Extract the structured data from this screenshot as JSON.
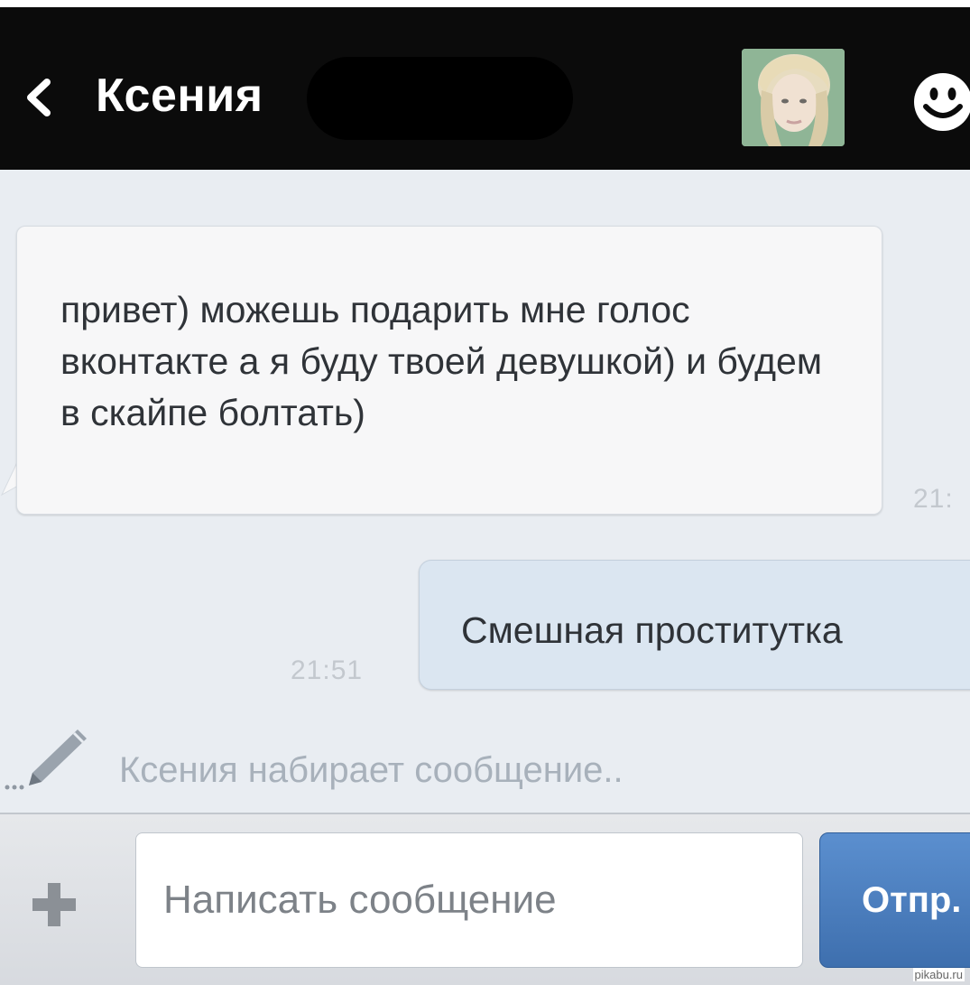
{
  "header": {
    "back_icon": "chevron-left-icon",
    "contact_name": "Ксения",
    "smiley_icon": "smiley-icon"
  },
  "messages": [
    {
      "direction": "incoming",
      "text": "привет) можешь подарить мне голос вконтакте а я буду твоей девушкой) и будем в скайпе болтать)",
      "time": "21:"
    },
    {
      "direction": "outgoing",
      "text": "Смешная проститутка",
      "time": "21:51"
    }
  ],
  "typing_indicator": {
    "icon": "pencil-icon",
    "text": "Ксения набирает сообщение.."
  },
  "composer": {
    "plus_icon": "plus-icon",
    "placeholder": "Написать сообщение",
    "send_label": "Отпр."
  },
  "watermark": "pikabu.ru",
  "colors": {
    "header_bg": "#0b0b0b",
    "chat_bg": "#e9edf2",
    "outgoing_bubble": "#dbe6f1",
    "send_button": "#4a7dbf"
  }
}
